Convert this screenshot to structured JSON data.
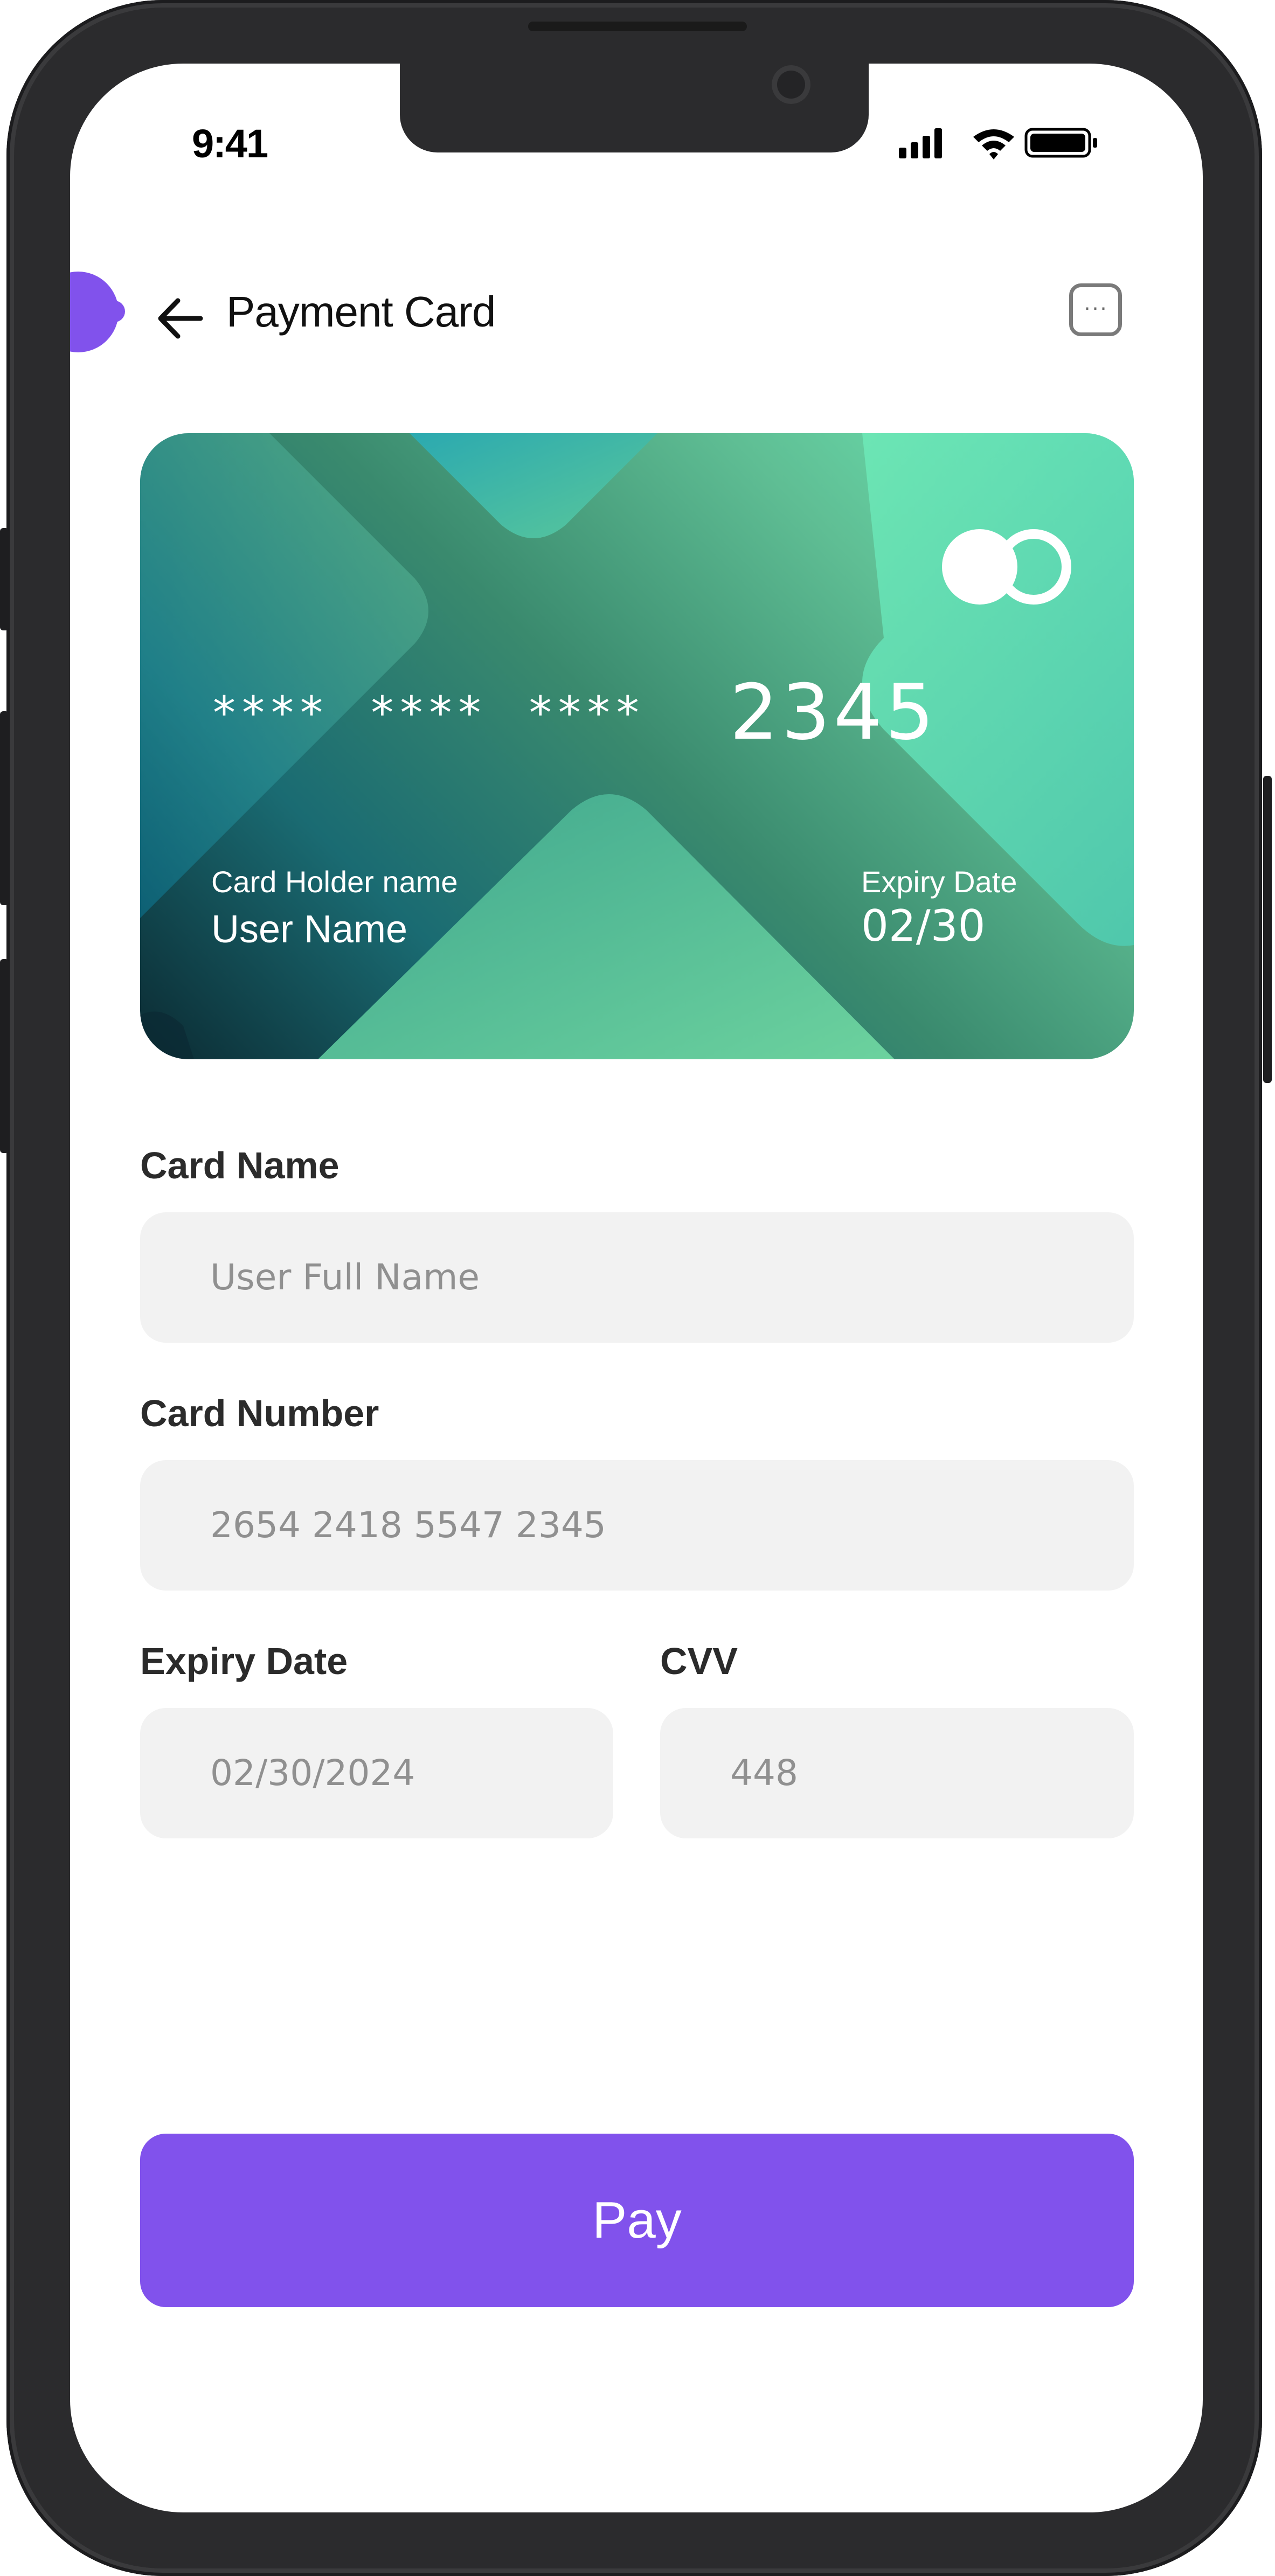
{
  "status_bar": {
    "time": "9:41",
    "icons": [
      "signal-icon",
      "wifi-icon",
      "battery-icon"
    ]
  },
  "header": {
    "title": "Payment Card",
    "back_icon": "arrow-left-icon",
    "more_icon": "more-icon",
    "more_glyph": "···"
  },
  "card": {
    "masked_number": "****  ****  ****",
    "last_four": "2345",
    "holder_label": "Card Holder name",
    "holder_name": "User Name",
    "expiry_label": "Expiry Date",
    "expiry_value": "02/30",
    "brand_icon": "mastercard-icon"
  },
  "form": {
    "card_name": {
      "label": "Card Name",
      "placeholder": "User Full Name"
    },
    "card_number": {
      "label": "Card Number",
      "placeholder": "2654 2418 5547 2345"
    },
    "expiry_date": {
      "label": "Expiry Date",
      "placeholder": "02/30/2024"
    },
    "cvv": {
      "label": "CVV",
      "placeholder": "448"
    }
  },
  "pay_button": {
    "label": "Pay"
  },
  "colors": {
    "accent": "#8152ec",
    "field_bg": "#f2f2f2",
    "frame": "#2b2b2d"
  }
}
